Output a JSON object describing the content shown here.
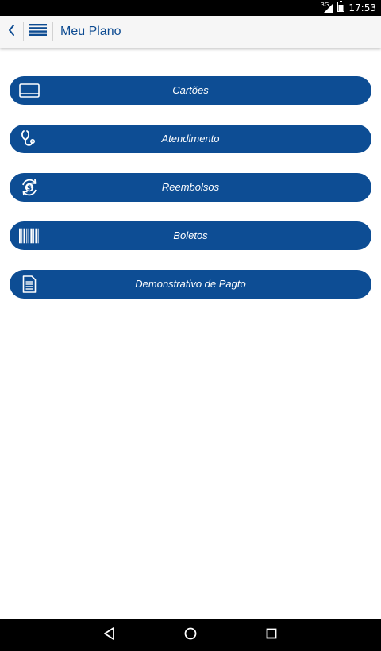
{
  "status_bar": {
    "network": "3G",
    "time": "17:53"
  },
  "header": {
    "title": "Meu Plano",
    "back_icon": "chevron-left-icon",
    "menu_icon": "list-menu-icon"
  },
  "menu": {
    "items": [
      {
        "label": "Cartões",
        "icon": "card-icon"
      },
      {
        "label": "Atendimento",
        "icon": "stethoscope-icon"
      },
      {
        "label": "Reembolsos",
        "icon": "refund-cycle-icon"
      },
      {
        "label": "Boletos",
        "icon": "barcode-icon"
      },
      {
        "label": "Demonstrativo de Pagto",
        "icon": "document-icon"
      }
    ]
  },
  "nav_bar": {
    "buttons": [
      "back-icon",
      "home-icon",
      "recent-apps-icon"
    ]
  },
  "colors": {
    "brand_blue": "#0d4d94",
    "title_blue": "#0e4c92",
    "header_bg": "#f6f6f6"
  }
}
